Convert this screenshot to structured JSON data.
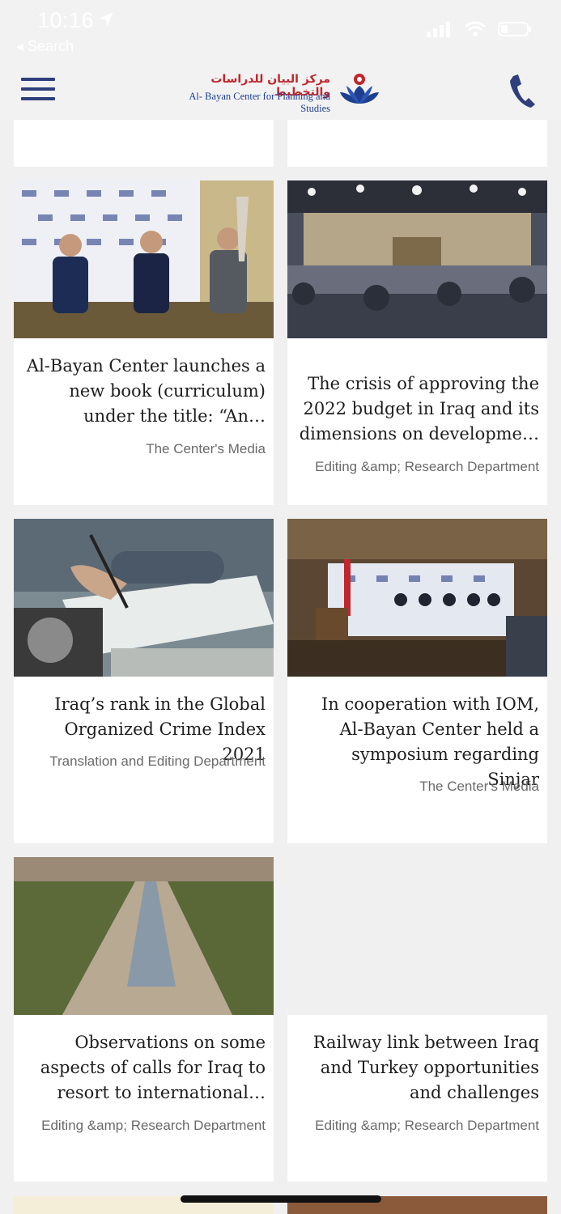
{
  "status_bar": {
    "time": "10:16",
    "back_label": "◂ Search"
  },
  "header": {
    "logo_arabic": "مركز البيان للدراسات والتخطيط",
    "logo_english": "Al- Bayan Center for Planning and Studies",
    "menu_icon": "hamburger-icon",
    "phone_icon": "phone-icon"
  },
  "articles": [
    {
      "title": "Al-Bayan Center launches a new book (curriculum) under the title: “An…",
      "source": "The Center's Media"
    },
    {
      "title": "The crisis of approving the 2022 budget in Iraq and its dimensions on developme…",
      "source": "Editing &amp; Research Department"
    },
    {
      "title": "Iraq’s rank in the Global Organized Crime Index 2021",
      "source": "Translation and Editing Department"
    },
    {
      "title": "In cooperation with IOM, Al-Bayan Center held a symposium regarding Sinjar",
      "source": "The Center's Media"
    },
    {
      "title": "Observations on some aspects of calls for Iraq to resort to international…",
      "source": "Editing &amp; Research Department"
    },
    {
      "title": "Railway link between Iraq and Turkey opportunities and challenges",
      "source": "Editing &amp; Research Department"
    }
  ],
  "colors": {
    "brand_blue": "#2e3f7c",
    "brand_red": "#c0262d",
    "background": "#f0f0f0"
  }
}
